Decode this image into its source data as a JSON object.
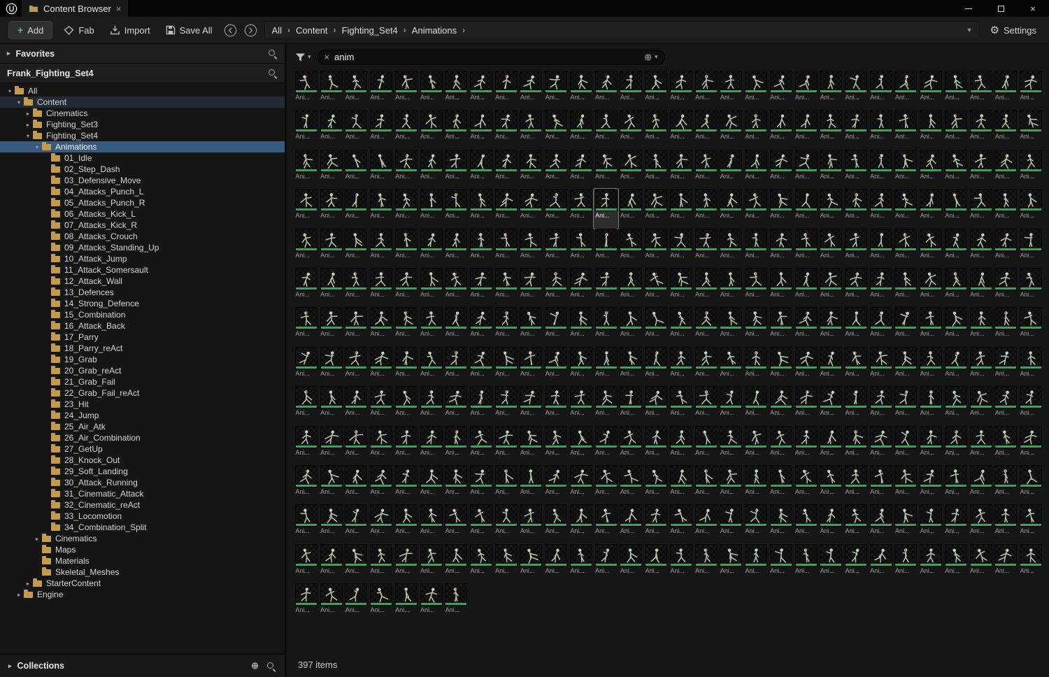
{
  "window": {
    "tab_title": "Content Browser"
  },
  "icons": {
    "tab_close": "×",
    "window_close": "×",
    "chevron_down": "▾",
    "chevron_right": "▸",
    "crumb_sep": "›",
    "gear": "⚙",
    "plus": "+",
    "circle_plus": "⊕",
    "clear": "×"
  },
  "toolbar": {
    "add_label": "Add",
    "fab_label": "Fab",
    "import_label": "Import",
    "save_all_label": "Save All",
    "settings_label": "Settings",
    "breadcrumb": [
      "All",
      "Content",
      "Fighting_Set4",
      "Animations"
    ]
  },
  "sidebar": {
    "favorites_label": "Favorites",
    "sources_label": "Frank_Fighting_Set4",
    "collections_label": "Collections",
    "tree": [
      {
        "label": "All",
        "level": 0,
        "arrow": "down",
        "state": ""
      },
      {
        "label": "Content",
        "level": 1,
        "arrow": "down",
        "state": "hover"
      },
      {
        "label": "Cinematics",
        "level": 2,
        "arrow": "right",
        "state": ""
      },
      {
        "label": "Fighting_Set3",
        "level": 2,
        "arrow": "right",
        "state": ""
      },
      {
        "label": "Fighting_Set4",
        "level": 2,
        "arrow": "down",
        "state": ""
      },
      {
        "label": "Animations",
        "level": 3,
        "arrow": "down",
        "state": "selected"
      },
      {
        "label": "01_Idle",
        "level": 4,
        "arrow": "none",
        "state": ""
      },
      {
        "label": "02_Step_Dash",
        "level": 4,
        "arrow": "none",
        "state": ""
      },
      {
        "label": "03_Defensive_Move",
        "level": 4,
        "arrow": "none",
        "state": ""
      },
      {
        "label": "04_Attacks_Punch_L",
        "level": 4,
        "arrow": "none",
        "state": ""
      },
      {
        "label": "05_Attacks_Punch_R",
        "level": 4,
        "arrow": "none",
        "state": ""
      },
      {
        "label": "06_Attacks_Kick_L",
        "level": 4,
        "arrow": "none",
        "state": ""
      },
      {
        "label": "07_Attacks_Kick_R",
        "level": 4,
        "arrow": "none",
        "state": ""
      },
      {
        "label": "08_Attacks_Crouch",
        "level": 4,
        "arrow": "none",
        "state": ""
      },
      {
        "label": "09_Attacks_Standing_Up",
        "level": 4,
        "arrow": "none",
        "state": ""
      },
      {
        "label": "10_Attack_Jump",
        "level": 4,
        "arrow": "none",
        "state": ""
      },
      {
        "label": "11_Attack_Somersault",
        "level": 4,
        "arrow": "none",
        "state": ""
      },
      {
        "label": "12_Attack_Wall",
        "level": 4,
        "arrow": "none",
        "state": ""
      },
      {
        "label": "13_Defences",
        "level": 4,
        "arrow": "none",
        "state": ""
      },
      {
        "label": "14_Strong_Defence",
        "level": 4,
        "arrow": "none",
        "state": ""
      },
      {
        "label": "15_Combination",
        "level": 4,
        "arrow": "none",
        "state": ""
      },
      {
        "label": "16_Attack_Back",
        "level": 4,
        "arrow": "none",
        "state": ""
      },
      {
        "label": "17_Parry",
        "level": 4,
        "arrow": "none",
        "state": ""
      },
      {
        "label": "18_Parry_reAct",
        "level": 4,
        "arrow": "none",
        "state": ""
      },
      {
        "label": "19_Grab",
        "level": 4,
        "arrow": "none",
        "state": ""
      },
      {
        "label": "20_Grab_reAct",
        "level": 4,
        "arrow": "none",
        "state": ""
      },
      {
        "label": "21_Grab_Fail",
        "level": 4,
        "arrow": "none",
        "state": ""
      },
      {
        "label": "22_Grab_Fail_reAct",
        "level": 4,
        "arrow": "none",
        "state": ""
      },
      {
        "label": "23_Hit",
        "level": 4,
        "arrow": "none",
        "state": ""
      },
      {
        "label": "24_Jump",
        "level": 4,
        "arrow": "none",
        "state": ""
      },
      {
        "label": "25_Air_Atk",
        "level": 4,
        "arrow": "none",
        "state": ""
      },
      {
        "label": "26_Air_Combination",
        "level": 4,
        "arrow": "none",
        "state": ""
      },
      {
        "label": "27_GetUp",
        "level": 4,
        "arrow": "none",
        "state": ""
      },
      {
        "label": "28_Knock_Out",
        "level": 4,
        "arrow": "none",
        "state": ""
      },
      {
        "label": "29_Soft_Landing",
        "level": 4,
        "arrow": "none",
        "state": ""
      },
      {
        "label": "30_Attack_Running",
        "level": 4,
        "arrow": "none",
        "state": ""
      },
      {
        "label": "31_Cinematic_Attack",
        "level": 4,
        "arrow": "none",
        "state": ""
      },
      {
        "label": "32_Cinematic_reAct",
        "level": 4,
        "arrow": "none",
        "state": ""
      },
      {
        "label": "33_Locomotion",
        "level": 4,
        "arrow": "none",
        "state": ""
      },
      {
        "label": "34_Combination_Split",
        "level": 4,
        "arrow": "none",
        "state": ""
      },
      {
        "label": "Cinematics",
        "level": 3,
        "arrow": "right",
        "state": ""
      },
      {
        "label": "Maps",
        "level": 3,
        "arrow": "none",
        "state": ""
      },
      {
        "label": "Materials",
        "level": 3,
        "arrow": "none",
        "state": ""
      },
      {
        "label": "Skeletal_Meshes",
        "level": 3,
        "arrow": "none",
        "state": ""
      },
      {
        "label": "StarterContent",
        "level": 2,
        "arrow": "right",
        "state": ""
      },
      {
        "label": "Engine",
        "level": 1,
        "arrow": "right",
        "state": ""
      }
    ]
  },
  "search": {
    "value": "anim"
  },
  "grid": {
    "count": 397,
    "columns": 30,
    "item_label": "Ani...",
    "selected_index": 102,
    "type_color": "#3fa15c"
  },
  "status": {
    "items_label": "397 items"
  }
}
